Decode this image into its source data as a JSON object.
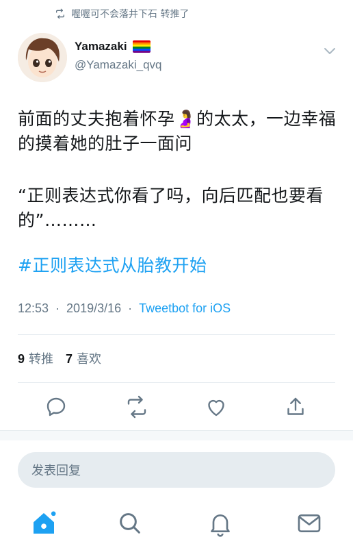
{
  "retweet_banner": {
    "text": "喔喔可不会落井下石 转推了",
    "icon": "retweet-icon"
  },
  "author": {
    "display_name": "Yamazaki",
    "handle": "@Yamazaki_qvq",
    "flag_icon": "rainbow-flag-icon"
  },
  "tweet": {
    "line1": "前面的丈夫抱着怀孕🤰的太太，一边幸福的摸着她的肚子一面问",
    "line2": "“正则表达式你看了吗，向后匹配也要看的”………",
    "hashtag": "#正则表达式从胎教开始"
  },
  "meta": {
    "time": "12:53",
    "sep1": "·",
    "date": "2019/3/16",
    "sep2": "·",
    "source": "Tweetbot for iOS"
  },
  "stats": {
    "retweet_count": "9",
    "retweet_label": "转推",
    "like_count": "7",
    "like_label": "喜欢"
  },
  "actions": [
    "reply-icon",
    "retweet-icon",
    "like-icon",
    "share-icon"
  ],
  "reply_box": {
    "placeholder": "发表回复"
  },
  "tabbar": [
    "home-icon",
    "search-icon",
    "notifications-icon",
    "messages-icon"
  ],
  "colors": {
    "accent": "#1da1f2",
    "muted": "#657786",
    "divider": "#e6ecf0"
  }
}
